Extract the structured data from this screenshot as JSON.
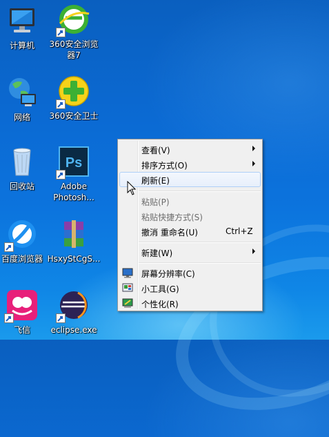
{
  "desktop": {
    "icons": [
      {
        "label": "计算机"
      },
      {
        "label": "360安全浏览\n器7"
      },
      {
        "label": "网络"
      },
      {
        "label": "360安全卫士"
      },
      {
        "label": "回收站"
      },
      {
        "label": "Adobe\nPhotosh..."
      },
      {
        "label": "百度浏览器"
      },
      {
        "label": "HsxyStCgS..."
      },
      {
        "label": "飞信"
      },
      {
        "label": "eclipse.exe"
      }
    ]
  },
  "context_menu": {
    "items": [
      {
        "label": "查看(V)"
      },
      {
        "label": "排序方式(O)"
      },
      {
        "label": "刷新(E)"
      },
      {
        "label": "粘贴(P)"
      },
      {
        "label": "粘贴快捷方式(S)"
      },
      {
        "label": "撤消 重命名(U)",
        "shortcut": "Ctrl+Z"
      },
      {
        "label": "新建(W)"
      },
      {
        "label": "屏幕分辨率(C)"
      },
      {
        "label": "小工具(G)"
      },
      {
        "label": "个性化(R)"
      }
    ]
  }
}
